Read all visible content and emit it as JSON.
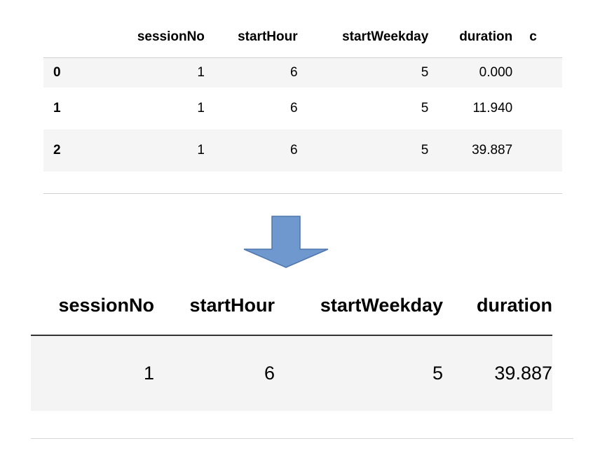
{
  "top_table": {
    "columns": [
      "",
      "sessionNo",
      "startHour",
      "startWeekday",
      "duration",
      "c"
    ],
    "rows": [
      {
        "index": "0",
        "sessionNo": "1",
        "startHour": "6",
        "startWeekday": "5",
        "duration": "0.000"
      },
      {
        "index": "1",
        "sessionNo": "1",
        "startHour": "6",
        "startWeekday": "5",
        "duration": "11.940"
      },
      {
        "index": "2",
        "sessionNo": "1",
        "startHour": "6",
        "startWeekday": "5",
        "duration": "39.887"
      }
    ]
  },
  "arrow": {
    "icon": "down-arrow-icon",
    "fill": "#6f98cf",
    "stroke": "#4f77ad"
  },
  "bottom_table": {
    "columns": [
      "sessionNo",
      "startHour",
      "startWeekday",
      "duration"
    ],
    "row": {
      "sessionNo": "1",
      "startHour": "6",
      "startWeekday": "5",
      "duration": "39.887"
    }
  }
}
